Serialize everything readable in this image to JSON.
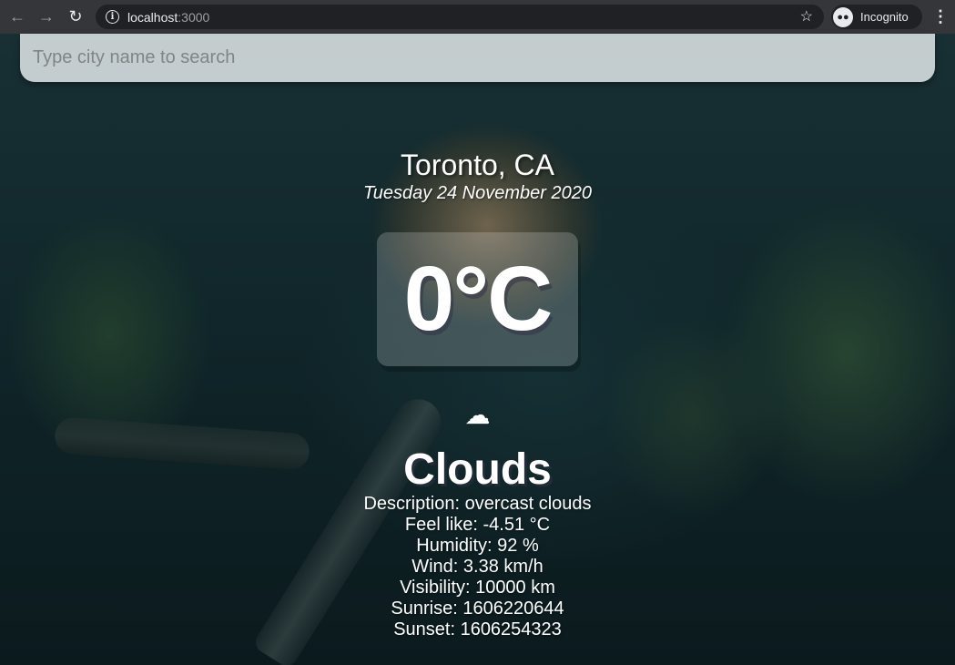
{
  "browser": {
    "url_host": "localhost",
    "url_port": ":3000",
    "incognito_label": "Incognito"
  },
  "search": {
    "placeholder": "Type city name to search",
    "value": ""
  },
  "weather": {
    "location": "Toronto, CA",
    "date": "Tuesday 24 November 2020",
    "temperature": "0°C",
    "icon": "cloud-icon",
    "main": "Clouds",
    "details": {
      "description": "Description: overcast clouds",
      "feels_like": "Feel like: -4.51 °C",
      "humidity": "Humidity: 92 %",
      "wind": "Wind: 3.38 km/h",
      "visibility": "Visibility: 10000 km",
      "sunrise": "Sunrise: 1606220644",
      "sunset": "Sunset: 1606254323"
    }
  }
}
